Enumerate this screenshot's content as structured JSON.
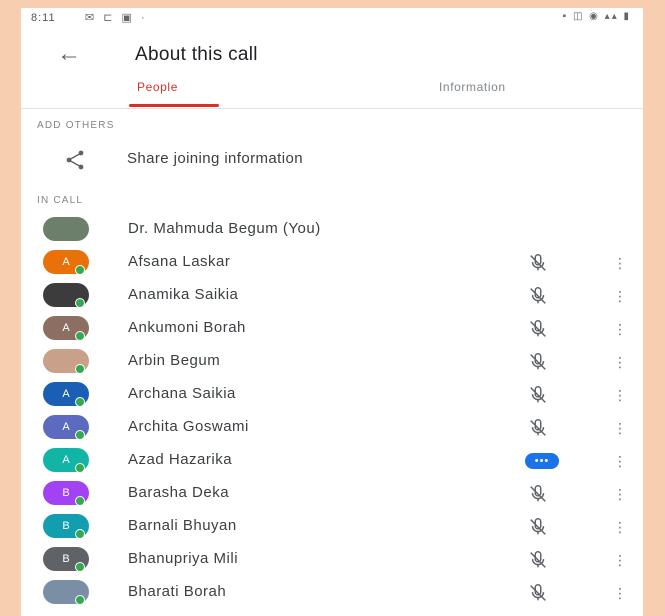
{
  "status_bar": {
    "time": "8:11",
    "icons_left": [
      "mail-icon",
      "cast-icon",
      "photo-icon",
      "dot-icon"
    ],
    "icons_right": [
      "battery-icon",
      "signal-icon",
      "wifi-icon",
      "lte-icon"
    ]
  },
  "app_bar": {
    "title": "About this call",
    "back_icon": "back-arrow-icon"
  },
  "tabs": [
    {
      "label": "People",
      "active": true
    },
    {
      "label": "Information",
      "active": false
    }
  ],
  "sections": {
    "add_others": "ADD OTHERS",
    "in_call": "IN CALL"
  },
  "share": {
    "label": "Share joining information",
    "icon": "share-icon"
  },
  "participants": [
    {
      "name": "Dr. Mahmuda Begum (You)",
      "avatar": "photo",
      "color": "#6b7f6a",
      "status": "none"
    },
    {
      "name": "Afsana Laskar",
      "avatar": "A",
      "color": "#e8710a",
      "status": "muted"
    },
    {
      "name": "Anamika Saikia",
      "avatar": "photo",
      "color": "#3c3c3c",
      "status": "muted"
    },
    {
      "name": "Ankumoni Borah",
      "avatar": "A",
      "color": "#8d6e63",
      "status": "muted"
    },
    {
      "name": "Arbin Begum",
      "avatar": "photo",
      "color": "#c9a08a",
      "status": "muted"
    },
    {
      "name": "Archana Saikia",
      "avatar": "A",
      "color": "#1a5fb4",
      "status": "muted"
    },
    {
      "name": "Archita Goswami",
      "avatar": "A",
      "color": "#5c6bc0",
      "status": "muted"
    },
    {
      "name": "Azad Hazarika",
      "avatar": "A",
      "color": "#12b5a5",
      "status": "talking",
      "talking_label": "•••"
    },
    {
      "name": "Barasha Deka",
      "avatar": "B",
      "color": "#a142f4",
      "status": "muted"
    },
    {
      "name": "Barnali Bhuyan",
      "avatar": "B",
      "color": "#129eaf",
      "status": "muted"
    },
    {
      "name": "Bhanupriya Mili",
      "avatar": "B",
      "color": "#5f6368",
      "status": "muted"
    },
    {
      "name": "Bharati Borah",
      "avatar": "photo",
      "color": "#7a8fa6",
      "status": "muted"
    }
  ],
  "more_glyph": "⋮",
  "colors": {
    "accent": "#d93025",
    "online": "#34a853",
    "talking": "#1a73e8"
  }
}
